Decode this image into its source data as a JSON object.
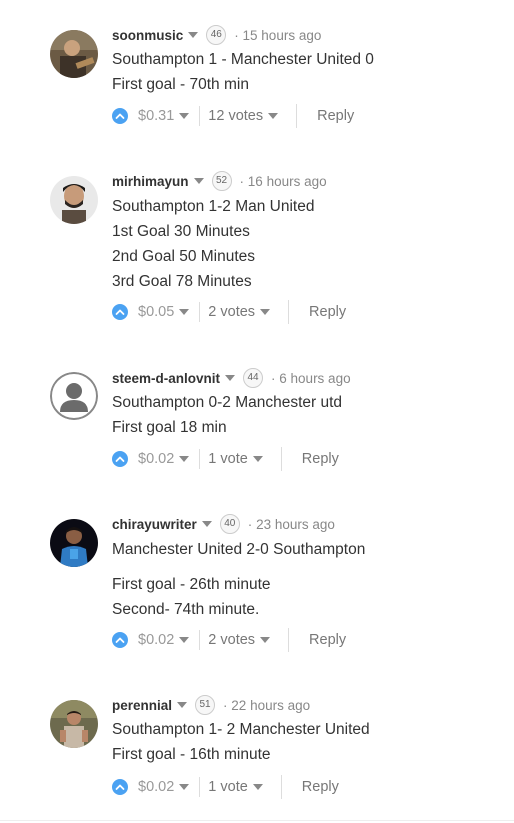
{
  "comments": [
    {
      "author": "soonmusic",
      "reputation": "46",
      "time": "15 hours ago",
      "lines": [
        "Southampton 1 - Manchester United 0",
        "First goal - 70th min"
      ],
      "payout": "$0.31",
      "votes": "12 votes",
      "reply": "Reply",
      "avatar_icon": "photo-avatar-icon"
    },
    {
      "author": "mirhimayun",
      "reputation": "52",
      "time": "16 hours ago",
      "lines": [
        "Southampton 1-2 Man United",
        "1st Goal 30 Minutes",
        "2nd Goal 50 Minutes",
        "3rd Goal 78 Minutes"
      ],
      "payout": "$0.05",
      "votes": "2 votes",
      "reply": "Reply",
      "avatar_icon": "photo-avatar-icon"
    },
    {
      "author": "steem-d-anlovnit",
      "reputation": "44",
      "time": "6 hours ago",
      "lines": [
        "Southampton 0-2 Manchester utd",
        "First goal 18 min"
      ],
      "payout": "$0.02",
      "votes": "1 vote",
      "reply": "Reply",
      "avatar_icon": "default-person-icon"
    },
    {
      "author": "chirayuwriter",
      "reputation": "40",
      "time": "23 hours ago",
      "lines": [
        "Manchester United 2-0 Southampton",
        "",
        "First goal - 26th minute",
        "Second- 74th minute."
      ],
      "payout": "$0.02",
      "votes": "2 votes",
      "reply": "Reply",
      "avatar_icon": "photo-avatar-icon"
    },
    {
      "author": "perennial",
      "reputation": "51",
      "time": "22 hours ago",
      "lines": [
        "Southampton 1- 2 Manchester United",
        "First goal - 16th minute"
      ],
      "payout": "$0.02",
      "votes": "1 vote",
      "reply": "Reply",
      "avatar_icon": "photo-avatar-icon"
    }
  ],
  "dot_separator": "·",
  "colors": {
    "upvote_blue": "#4ba2f2",
    "text": "#333333",
    "muted": "#999999"
  }
}
